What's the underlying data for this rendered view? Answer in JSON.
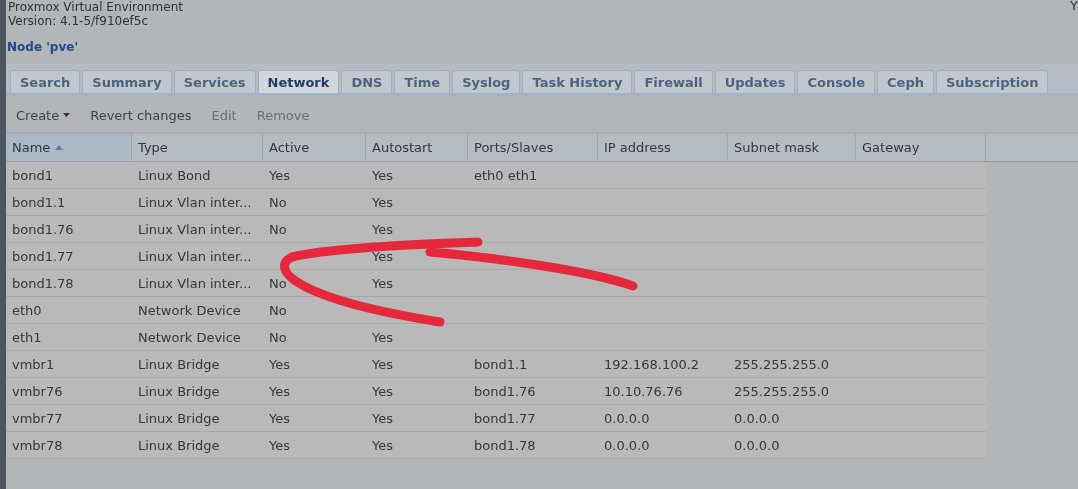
{
  "header": {
    "title": "Proxmox Virtual Environment",
    "version": "Version: 4.1-5/f910ef5c",
    "user_fragment": "Y"
  },
  "panel": {
    "title": "Node 'pve'"
  },
  "tabs": [
    {
      "label": "Search",
      "selected": false
    },
    {
      "label": "Summary",
      "selected": false
    },
    {
      "label": "Services",
      "selected": false
    },
    {
      "label": "Network",
      "selected": true
    },
    {
      "label": "DNS",
      "selected": false
    },
    {
      "label": "Time",
      "selected": false
    },
    {
      "label": "Syslog",
      "selected": false
    },
    {
      "label": "Task History",
      "selected": false
    },
    {
      "label": "Firewall",
      "selected": false
    },
    {
      "label": "Updates",
      "selected": false
    },
    {
      "label": "Console",
      "selected": false
    },
    {
      "label": "Ceph",
      "selected": false
    },
    {
      "label": "Subscription",
      "selected": false
    }
  ],
  "toolbar": [
    {
      "label": "Create",
      "kind": "menu",
      "disabled": false
    },
    {
      "label": "Revert changes",
      "kind": "button",
      "disabled": false
    },
    {
      "label": "Edit",
      "kind": "button",
      "disabled": true
    },
    {
      "label": "Remove",
      "kind": "button",
      "disabled": true
    }
  ],
  "table": {
    "columns": [
      {
        "label": "Name",
        "sorted": true
      },
      {
        "label": "Type",
        "sorted": false
      },
      {
        "label": "Active",
        "sorted": false
      },
      {
        "label": "Autostart",
        "sorted": false
      },
      {
        "label": "Ports/Slaves",
        "sorted": false
      },
      {
        "label": "IP address",
        "sorted": false
      },
      {
        "label": "Subnet mask",
        "sorted": false
      },
      {
        "label": "Gateway",
        "sorted": false
      }
    ],
    "rows": [
      [
        "bond1",
        "Linux Bond",
        "Yes",
        "Yes",
        "eth0 eth1",
        null,
        null,
        null
      ],
      [
        "bond1.1",
        "Linux Vlan inter...",
        "No",
        "Yes",
        null,
        null,
        null,
        null
      ],
      [
        "bond1.76",
        "Linux Vlan inter...",
        "No",
        "Yes",
        null,
        null,
        null,
        null
      ],
      [
        "bond1.77",
        "Linux Vlan inter...",
        null,
        "Yes",
        null,
        null,
        null,
        null
      ],
      [
        "bond1.78",
        "Linux Vlan inter...",
        "No",
        "Yes",
        null,
        null,
        null,
        null
      ],
      [
        "eth0",
        "Network Device",
        "No",
        null,
        null,
        null,
        null,
        null
      ],
      [
        "eth1",
        "Network Device",
        "No",
        "Yes",
        null,
        null,
        null,
        null
      ],
      [
        "vmbr1",
        "Linux Bridge",
        "Yes",
        "Yes",
        "bond1.1",
        "192.168.100.2",
        "255.255.255.0",
        null
      ],
      [
        "vmbr76",
        "Linux Bridge",
        "Yes",
        "Yes",
        "bond1.76",
        "10.10.76.76",
        "255.255.255.0",
        null
      ],
      [
        "vmbr77",
        "Linux Bridge",
        "Yes",
        "Yes",
        "bond1.77",
        "0.0.0.0",
        "0.0.0.0",
        null
      ],
      [
        "vmbr78",
        "Linux Bridge",
        "Yes",
        "Yes",
        "bond1.78",
        "0.0.0.0",
        "0.0.0.0",
        null
      ]
    ]
  },
  "annotation": {
    "kind": "scribble",
    "color": "#e5283c"
  }
}
